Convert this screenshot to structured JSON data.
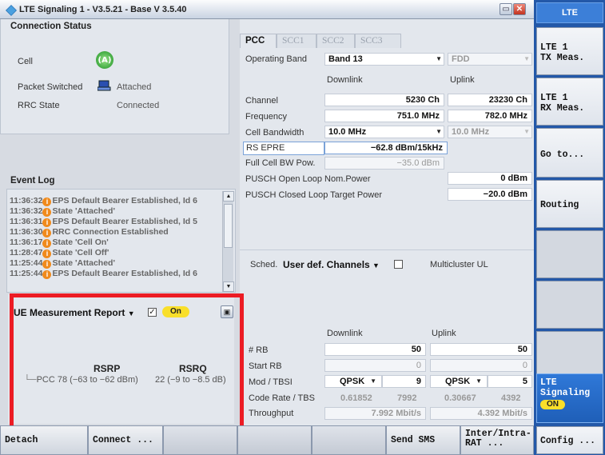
{
  "window": {
    "title": "LTE Signaling 1 - V3.5.21 - Base V 3.5.40"
  },
  "connection_status": {
    "header": "Connection Status",
    "cell_label": "Cell",
    "cell_icon_text": "(A)",
    "packet_switched_label": "Packet Switched",
    "packet_switched_value": "Attached",
    "rrc_state_label": "RRC State",
    "rrc_state_value": "Connected"
  },
  "event_log": {
    "header": "Event Log",
    "events": [
      {
        "time": "11:36:32",
        "text": "EPS Default Bearer Established, Id 6"
      },
      {
        "time": "11:36:32",
        "text": "State 'Attached'"
      },
      {
        "time": "11:36:31",
        "text": "EPS Default Bearer Established, Id 5"
      },
      {
        "time": "11:36:30",
        "text": "RRC Connection Established"
      },
      {
        "time": "11:36:17",
        "text": "State 'Cell On'"
      },
      {
        "time": "11:28:47",
        "text": "State 'Cell Off'"
      },
      {
        "time": "11:25:44",
        "text": "State 'Attached'"
      },
      {
        "time": "11:25:44",
        "text": "EPS Default Bearer Established, Id 6"
      }
    ]
  },
  "ue_meas": {
    "dropdown_label": "UE Measurement Report",
    "on_label": "On",
    "col_rsrp": "RSRP",
    "col_rsrq": "RSRQ",
    "row_label": "PCC",
    "rsrp": "78 (−63 to −62 dBm)",
    "rsrq": "22 (−9 to −8.5 dB)"
  },
  "tabs": [
    "PCC",
    "SCC1",
    "SCC2",
    "SCC3"
  ],
  "pcc": {
    "operating_band_label": "Operating Band",
    "operating_band": "Band 13",
    "duplex": "FDD",
    "downlink": "Downlink",
    "uplink": "Uplink",
    "channel_label": "Channel",
    "channel_dl": "5230  Ch",
    "channel_ul": "23230  Ch",
    "frequency_label": "Frequency",
    "frequency_dl": "751.0  MHz",
    "frequency_ul": "782.0  MHz",
    "bw_label": "Cell Bandwidth",
    "bw_dl": "10.0 MHz",
    "bw_ul": "10.0 MHz",
    "rsepre_label": "RS EPRE",
    "rsepre": "−62.8  dBm/15kHz",
    "fullbw_label": "Full Cell BW Pow.",
    "fullbw": "−35.0  dBm",
    "pusch_open_label": "PUSCH Open Loop Nom.Power",
    "pusch_open": "0 dBm",
    "pusch_closed_label": "PUSCH Closed Loop Target Power",
    "pusch_closed": "−20.0  dBm"
  },
  "sched": {
    "label": "Sched.",
    "value": "User def. Channels",
    "multicluster": "Multicluster UL",
    "downlink": "Downlink",
    "uplink": "Uplink",
    "rb_label": "# RB",
    "rb_dl": "50",
    "rb_ul": "50",
    "start_rb_label": "Start RB",
    "start_rb_dl": "0",
    "start_rb_ul": "0",
    "mod_label": "Mod / TBSI",
    "mod_dl": "QPSK",
    "tbsi_dl": "9",
    "mod_ul": "QPSK",
    "tbsi_ul": "5",
    "code_label": "Code Rate / TBS",
    "code_dl": "0.61852",
    "tbs_dl": "7992",
    "code_ul": "0.30667",
    "tbs_ul": "4392",
    "tp_label": "Throughput",
    "tp_dl": "7.992  Mbit/s",
    "tp_ul": "4.392  Mbit/s"
  },
  "softkeys": {
    "top": "LTE",
    "tx": "LTE 1\nTX Meas.",
    "rx": "LTE 1\nRX Meas.",
    "goto": "Go to...",
    "routing": "Routing",
    "lte_signaling": "LTE\nSignaling",
    "lte_on": "ON",
    "config": "Config ..."
  },
  "bottom": {
    "detach": "Detach",
    "connect": "Connect ...",
    "send_sms": "Send SMS",
    "inter_intra": "Inter/Intra-\nRAT ..."
  }
}
